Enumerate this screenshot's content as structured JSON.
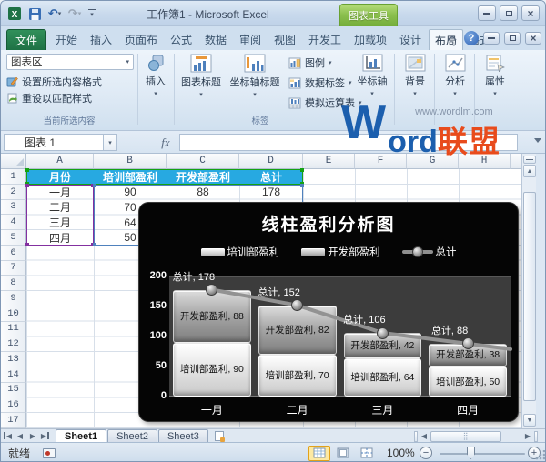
{
  "window": {
    "title": "工作簿1 - Microsoft Excel",
    "context_tool": "图表工具"
  },
  "ribbon_tabs": {
    "file": "文件",
    "items": [
      "开始",
      "插入",
      "页面布",
      "公式",
      "数据",
      "审阅",
      "视图",
      "开发工",
      "加载项"
    ],
    "contextual": [
      "设计",
      "布局",
      "格式"
    ],
    "active": "布局"
  },
  "ribbon": {
    "current_selection": {
      "dropdown_value": "图表区",
      "format_label": "设置所选内容格式",
      "reset_label": "重设以匹配样式",
      "group_label": "当前所选内容"
    },
    "insert_label": "插入",
    "labels_group": {
      "chart_title": "图表标题",
      "axis_titles": "坐标轴标题",
      "legend": "图例",
      "data_labels": "数据标签",
      "data_table": "模拟运算表",
      "group_label": "标签"
    },
    "axes_label": "坐标轴",
    "background_label": "背景",
    "analysis_label": "分析",
    "properties_label": "属性"
  },
  "formula_bar": {
    "name_box": "图表 1",
    "fx": "fx",
    "formula": ""
  },
  "watermark": {
    "w": "W",
    "ord": "ord",
    "lm": "联盟",
    "url": "www.wordlm.com"
  },
  "sheet": {
    "col_headers": [
      "A",
      "B",
      "C",
      "D",
      "E",
      "F",
      "G",
      "H"
    ],
    "row_numbers": [
      "1",
      "2",
      "3",
      "4",
      "5",
      "6",
      "7",
      "8",
      "9",
      "10",
      "11",
      "12",
      "13",
      "14",
      "15",
      "16",
      "17"
    ],
    "header_row": [
      "月份",
      "培训部盈利",
      "开发部盈利",
      "总计"
    ],
    "header_fill": "#27a9e1",
    "rows": [
      [
        "一月",
        "90",
        "88",
        "178"
      ],
      [
        "二月",
        "70"
      ],
      [
        "三月",
        "64"
      ],
      [
        "四月",
        "50"
      ]
    ]
  },
  "chart_data": {
    "type": "combo-stacked-column-line",
    "title": "线柱盈利分析图",
    "categories": [
      "一月",
      "二月",
      "三月",
      "四月"
    ],
    "series": [
      {
        "name": "培训部盈利",
        "type": "column-stacked",
        "values": [
          90,
          70,
          64,
          50
        ]
      },
      {
        "name": "开发部盈利",
        "type": "column-stacked",
        "values": [
          88,
          82,
          42,
          38
        ]
      },
      {
        "name": "总计",
        "type": "line",
        "values": [
          178,
          152,
          106,
          88
        ]
      }
    ],
    "ylim": [
      0,
      200
    ],
    "yticks": [
      0,
      50,
      100,
      150,
      200
    ],
    "legend_position": "top",
    "total_label_prefix": "总计",
    "chart_bg": "#050505",
    "plot_bg": "#3c3c3c"
  },
  "sheet_tabs": {
    "tabs": [
      "Sheet1",
      "Sheet2",
      "Sheet3"
    ],
    "active": "Sheet1"
  },
  "status_bar": {
    "ready": "就绪",
    "zoom": "100%"
  }
}
